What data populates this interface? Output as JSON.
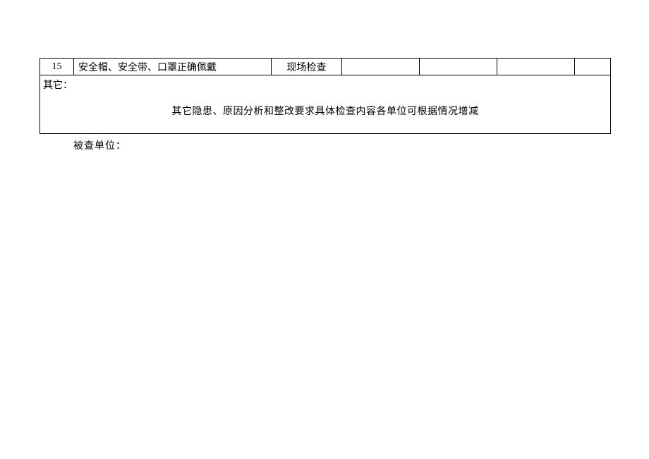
{
  "table": {
    "row15": {
      "num": "15",
      "item": "安全帽、安全带、口罩正确佩戴",
      "method": "现场检查"
    },
    "other": {
      "label": "其它：",
      "content": "其它隐患、原因分析和整改要求具体检查内容各单位可根据情况增减"
    }
  },
  "footer": {
    "inspected_unit_label": "被查单位："
  }
}
